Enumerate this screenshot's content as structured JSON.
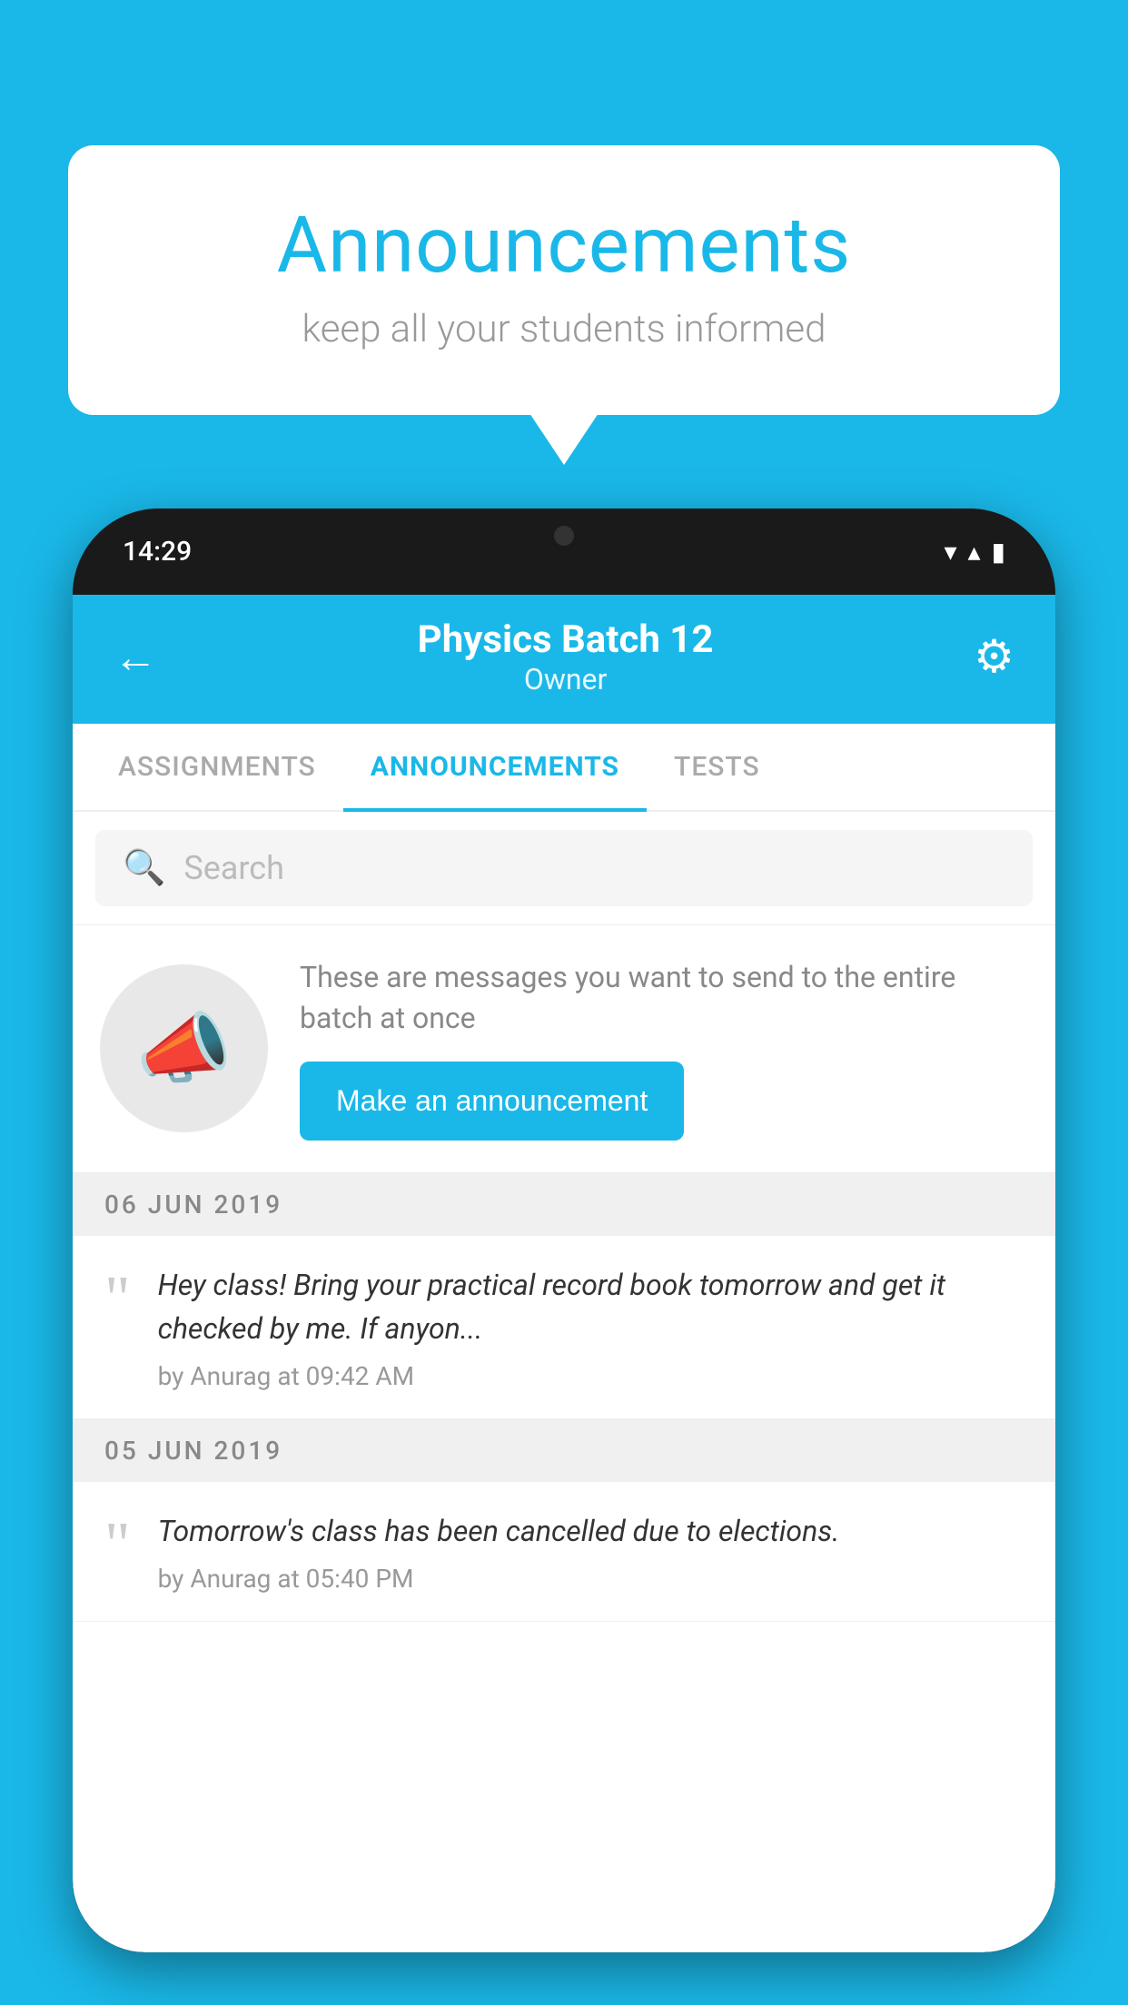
{
  "bubble": {
    "title": "Announcements",
    "subtitle": "keep all your students informed"
  },
  "status_bar": {
    "time": "14:29",
    "wifi_icon": "▼",
    "signal_icon": "◀",
    "battery_icon": "▮"
  },
  "header": {
    "title": "Physics Batch 12",
    "subtitle": "Owner",
    "back_label": "←",
    "gear_label": "⚙"
  },
  "tabs": [
    {
      "label": "ASSIGNMENTS",
      "active": false
    },
    {
      "label": "ANNOUNCEMENTS",
      "active": true
    },
    {
      "label": "TESTS",
      "active": false
    }
  ],
  "search": {
    "placeholder": "Search"
  },
  "announcement_prompt": {
    "description": "These are messages you want to send to the entire batch at once",
    "button_label": "Make an announcement"
  },
  "announcements": [
    {
      "date": "06  JUN  2019",
      "text": "Hey class! Bring your practical record book tomorrow and get it checked by me. If anyon...",
      "meta": "by Anurag at 09:42 AM"
    },
    {
      "date": "05  JUN  2019",
      "text": "Tomorrow's class has been cancelled due to elections.",
      "meta": "by Anurag at 05:40 PM"
    }
  ],
  "colors": {
    "brand": "#1ab8e8",
    "bg": "#1ab8e8",
    "white": "#ffffff"
  }
}
